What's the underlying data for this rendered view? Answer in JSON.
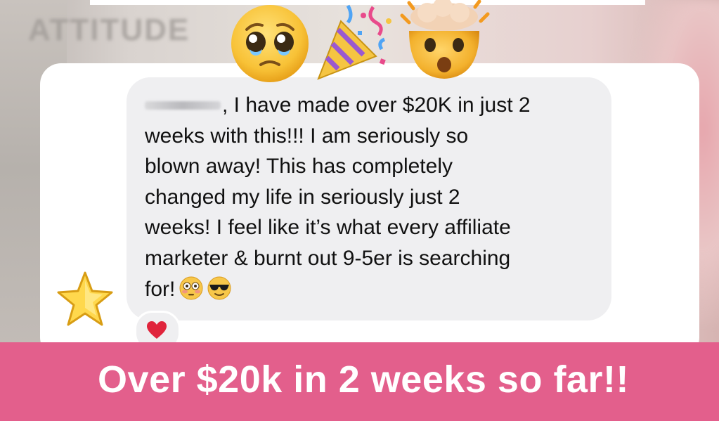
{
  "background": {
    "blurred_word": "ATTITUDE"
  },
  "message": {
    "line1_suffix": ", I have made over $20K in just 2",
    "line2": "weeks with this!!! I am seriously so",
    "line3": "blown away! This has completely",
    "line4": "changed my life in seriously just 2",
    "line5": "weeks! I feel like it’s what every affiliate",
    "line6": "marketer & burnt out 9-5er is searching",
    "line7": "for!",
    "trailing_emojis": [
      "flushed-face-icon",
      "sunglasses-face-icon"
    ]
  },
  "top_emojis": [
    "pleading-face-icon",
    "party-popper-icon",
    "exploding-head-icon"
  ],
  "avatar_icon": "star-icon",
  "reaction_icon": "red-heart-icon",
  "banner": {
    "text": "Over $20k in 2 weeks so far!!"
  },
  "colors": {
    "banner": "#e35f8c",
    "bubble": "#efeff1",
    "card": "#ffffff"
  }
}
